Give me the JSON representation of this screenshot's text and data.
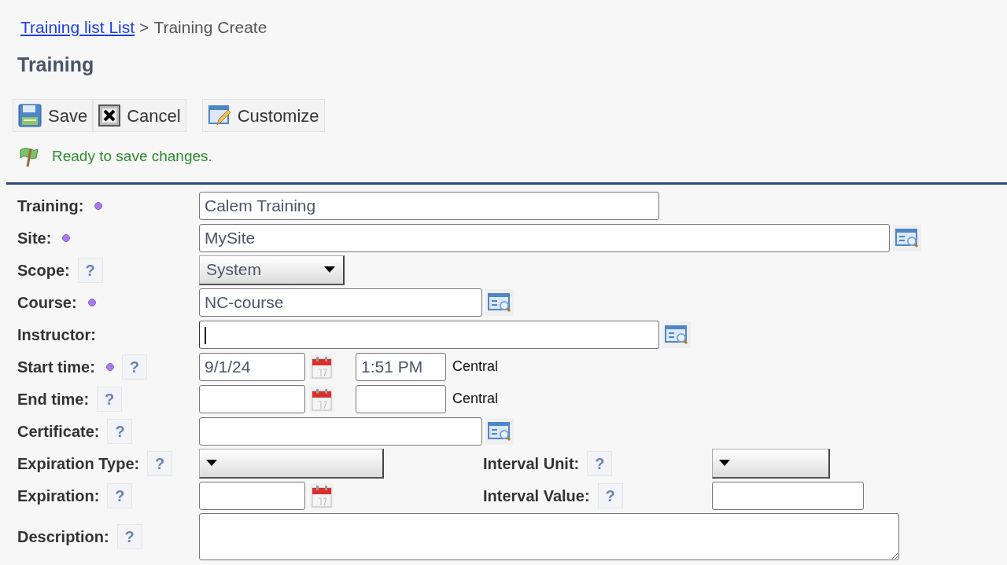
{
  "breadcrumb": {
    "link": "Training list List",
    "separator": ">",
    "current": "Training Create"
  },
  "title": "Training",
  "toolbar": [
    {
      "kind": "save",
      "label": "Save"
    },
    {
      "kind": "cancel",
      "label": "Cancel"
    },
    {
      "kind": "customize",
      "label": "Customize"
    }
  ],
  "status": "Ready to save changes.",
  "rows": [
    {
      "label": "Training:",
      "required": true,
      "control": {
        "kind": "text",
        "value": "Calem Training"
      }
    },
    {
      "label": "Site:",
      "required": true,
      "control": {
        "kind": "lookup",
        "value": "MySite"
      }
    },
    {
      "label": "Scope:",
      "required": false,
      "help": "?",
      "control": {
        "kind": "select",
        "value": "System"
      }
    },
    {
      "label": "Course:",
      "required": true,
      "control": {
        "kind": "lookup",
        "value": "NC-course"
      }
    },
    {
      "label": "Instructor:",
      "required": false,
      "control": {
        "kind": "lookup",
        "focused": true
      }
    },
    {
      "label": "Start time:",
      "required": true,
      "help": "?",
      "control": {
        "kind": "datetime",
        "date": "9/1/24",
        "time": "1:51 PM",
        "zone": "Central"
      }
    },
    {
      "label": "End time:",
      "required": false,
      "help": "?",
      "control": {
        "kind": "datetime",
        "zone": "Central"
      }
    },
    {
      "label": "Certificate:",
      "required": false,
      "help": "?",
      "control": {
        "kind": "lookup"
      }
    },
    {
      "label": "Expiration Type:",
      "required": false,
      "help": "?",
      "control": {
        "kind": "select"
      },
      "side": {
        "label": "Interval Unit:",
        "help": "?",
        "control": {
          "kind": "select"
        }
      }
    },
    {
      "label": "Expiration:",
      "required": false,
      "help": "?",
      "control": {
        "kind": "date"
      },
      "side": {
        "label": "Interval Value:",
        "help": "?",
        "control": {
          "kind": "text"
        }
      }
    },
    {
      "label": "Description:",
      "required": false,
      "help": "?",
      "control": {
        "kind": "textarea"
      }
    }
  ]
}
